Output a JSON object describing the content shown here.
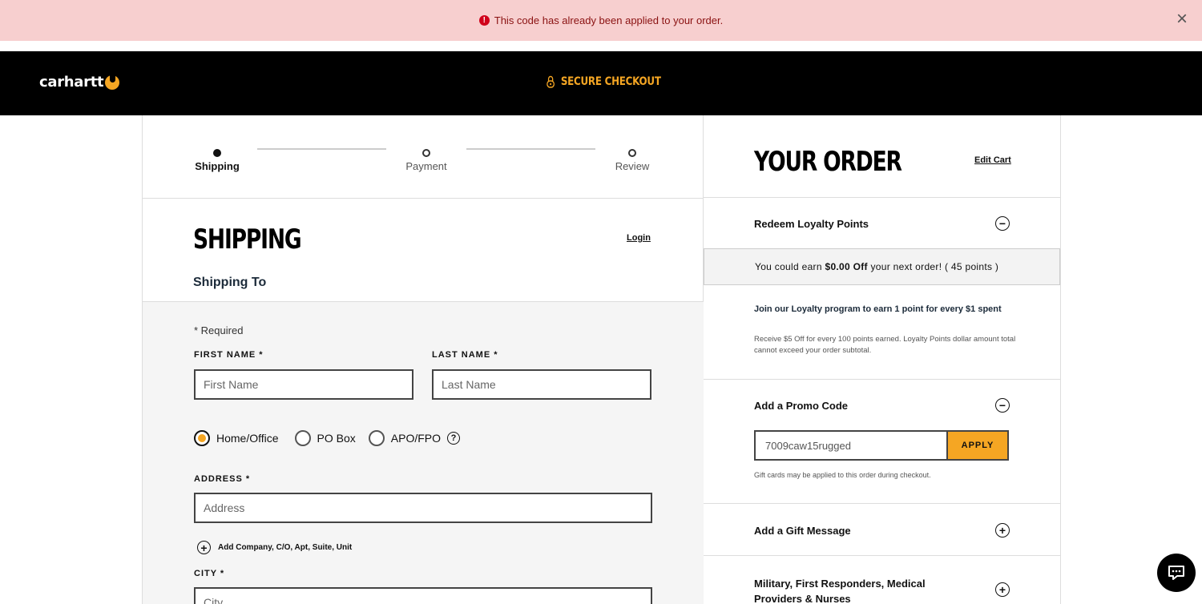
{
  "alert": {
    "message": "This code has already been applied to your order.",
    "icon": "error-icon",
    "close_icon": "close-icon"
  },
  "header": {
    "logo_text": "carhartt",
    "secure_label": "SECURE CHECKOUT",
    "accent": "#f5a623"
  },
  "steps": [
    {
      "label": "Shipping",
      "active": true
    },
    {
      "label": "Payment",
      "active": false
    },
    {
      "label": "Review",
      "active": false
    }
  ],
  "shipping": {
    "title": "SHIPPING",
    "login_label": "Login",
    "ship_to_label": "Shipping To",
    "required_note": "* Required",
    "first_name_label": "FIRST NAME *",
    "first_name_placeholder": "First Name",
    "last_name_label": "LAST NAME *",
    "last_name_placeholder": "Last Name",
    "address_types": [
      "Home/Office",
      "PO Box",
      "APO/FPO"
    ],
    "selected_address_type": "Home/Office",
    "address_label": "ADDRESS *",
    "address_placeholder": "Address",
    "add_company_label": "Add Company, C/O, Apt, Suite, Unit",
    "city_label": "CITY *",
    "city_placeholder": "City"
  },
  "order": {
    "title": "YOUR ORDER",
    "edit_cart_label": "Edit Cart",
    "loyalty": {
      "title": "Redeem Loyalty Points",
      "earn_prefix": "You could earn ",
      "earn_amount": "$0.00 Off",
      "earn_suffix": " your next order! ( 45 points )",
      "join_text": "Join our Loyalty program to earn 1 point for every $1 spent",
      "desc": "Receive $5 Off for every 100 points earned. Loyalty Points dollar amount total cannot exceed your order subtotal."
    },
    "promo": {
      "title": "Add a Promo Code",
      "value": "7009caw15rugged",
      "apply_label": "APPLY",
      "note": "Gift cards may be applied to this order during checkout."
    },
    "gift_message_title": "Add a Gift Message",
    "military_title": "Military, First Responders, Medical Providers & Nurses"
  }
}
